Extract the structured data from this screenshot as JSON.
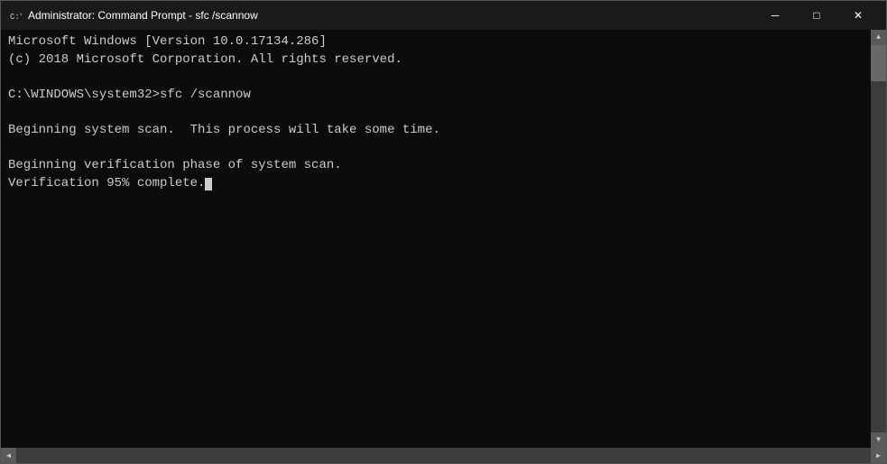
{
  "titlebar": {
    "icon": "cmd-icon",
    "title": "Administrator: Command Prompt - sfc /scannow",
    "minimize_label": "─",
    "maximize_label": "□",
    "close_label": "✕"
  },
  "terminal": {
    "line1": "Microsoft Windows [Version 10.0.17134.286]",
    "line2": "(c) 2018 Microsoft Corporation. All rights reserved.",
    "line3": "",
    "line4": "C:\\WINDOWS\\system32>sfc /scannow",
    "line5": "",
    "line6": "Beginning system scan.  This process will take some time.",
    "line7": "",
    "line8": "Beginning verification phase of system scan.",
    "line9_prefix": "Verification 95% complete."
  }
}
